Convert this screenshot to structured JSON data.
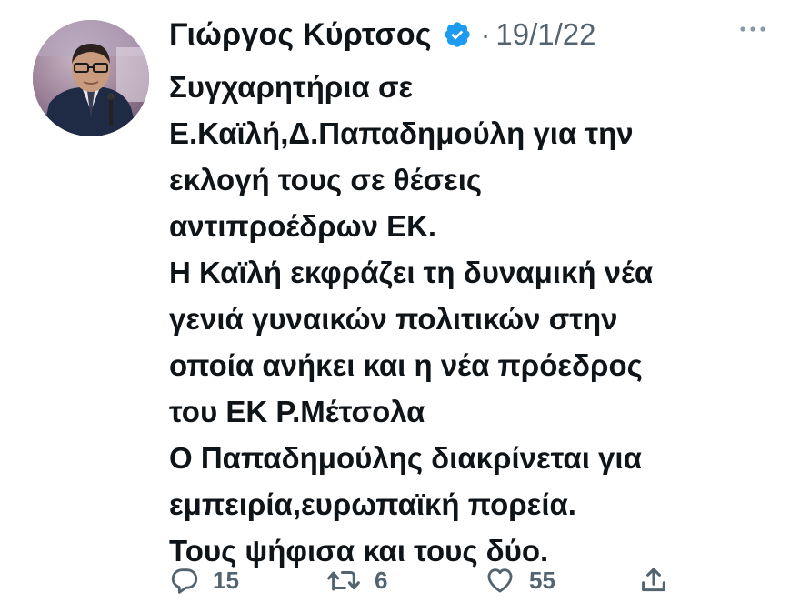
{
  "tweet": {
    "author": {
      "name": "Γιώργος Κύρτσος",
      "verified": true
    },
    "separator": "·",
    "date": "19/1/22",
    "lines": [
      "Συγχαρητήρια σε",
      "Ε.Καϊλή,Δ.Παπαδημούλη για την",
      "εκλογή τους σε θέσεις",
      "αντιπροέδρων ΕΚ.",
      "Η Καϊλή εκφράζει τη δυναμική νέα",
      "γενιά γυναικών πολιτικών στην",
      "οποία ανήκει και η νέα πρόεδρος",
      "του ΕΚ Ρ.Μέτσολα",
      "Ο Παπαδημούλης διακρίνεται για",
      "εμπειρία,ευρωπαϊκή πορεία.",
      "Τους ψήφισα και τους δύο."
    ],
    "actions": {
      "replies": "15",
      "retweets": "6",
      "likes": "55"
    }
  },
  "icons": {
    "verified": "verified-badge-icon",
    "more": "more-options-icon",
    "reply": "reply-icon",
    "retweet": "retweet-icon",
    "like": "like-icon",
    "share": "share-icon"
  },
  "colors": {
    "text": "#0f1419",
    "secondary": "#536471",
    "verified": "#1d9bf0",
    "background": "#ffffff"
  }
}
